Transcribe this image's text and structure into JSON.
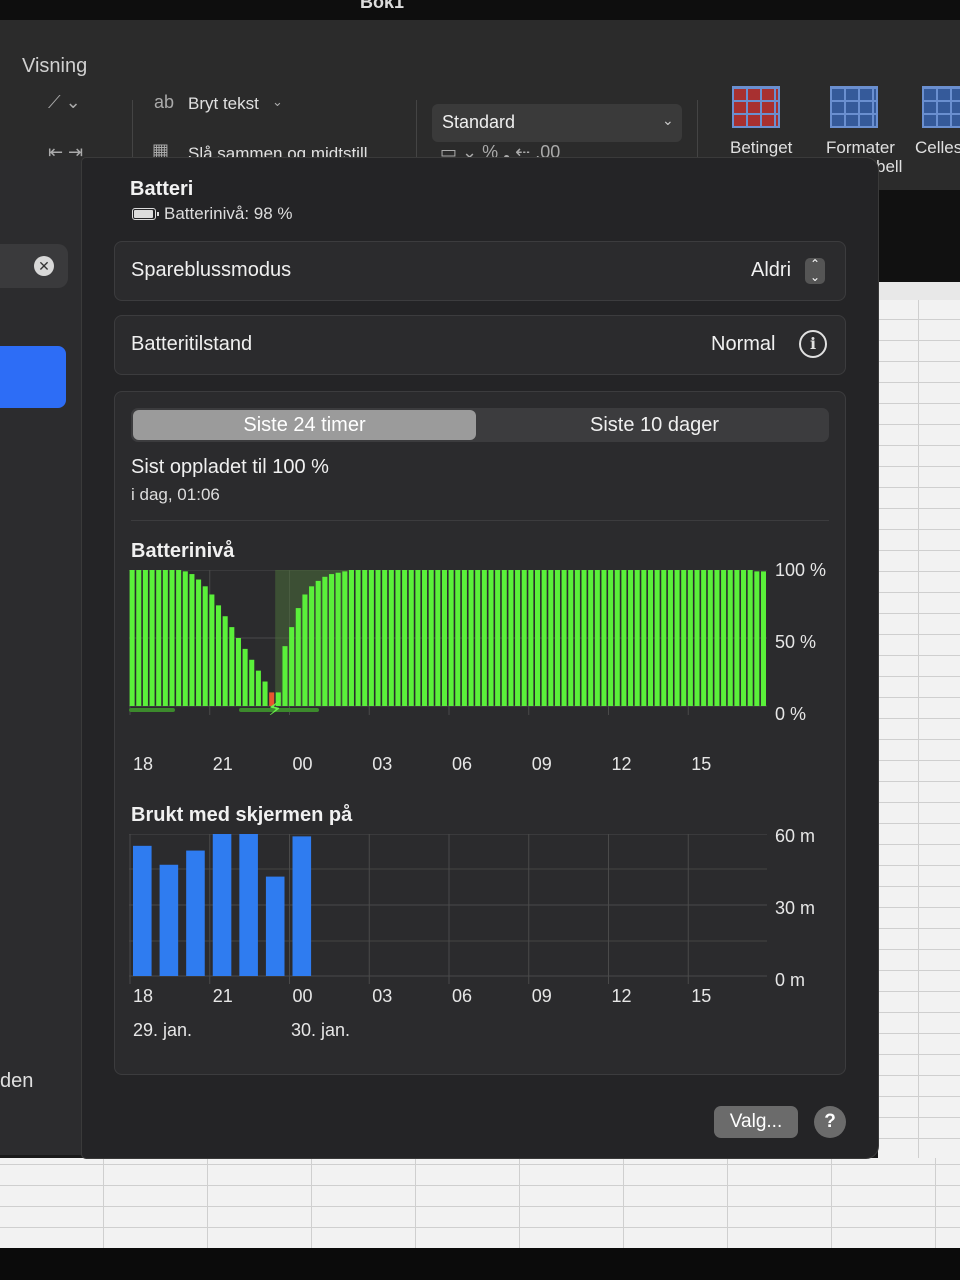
{
  "window": {
    "doc_title": "Bok1"
  },
  "ribbon": {
    "tab": "Visning",
    "wrap_text": "Bryt tekst",
    "merge_center": "Slå sammen og midtstill",
    "number_format": "Standard",
    "conditional": "Betinget",
    "format_table": "Formater",
    "format_table_2": "bell",
    "cell_styles": "Celles"
  },
  "settings": {
    "sidebar_partial_label": "den"
  },
  "battery_panel": {
    "title": "Batteri",
    "level_text": "Batterinivå: 98 %",
    "low_power_label": "Spareblussmodus",
    "low_power_value": "Aldri",
    "health_label": "Batteritilstand",
    "health_value": "Normal",
    "tabs": [
      "Siste 24 timer",
      "Siste 10 dager"
    ],
    "active_tab": "Siste 24 timer",
    "last_charged_title": "Sist oppladet til 100 %",
    "last_charged_time": "i dag, 01:06",
    "level_chart_title": "Batterinivå",
    "screen_chart_title": "Brukt med skjermen på",
    "options_button": "Valg...",
    "help_button": "?"
  },
  "chart_data": [
    {
      "type": "bar",
      "title": "Batterinivå",
      "x_tick_labels": [
        "18",
        "21",
        "00",
        "03",
        "06",
        "09",
        "12",
        "15"
      ],
      "y_tick_labels": [
        "100 %",
        "50 %",
        "0 %"
      ],
      "ylim": [
        0,
        100
      ],
      "grid": true,
      "bar_colors": {
        "normal": "#5af03a",
        "low": "#e8552e"
      },
      "charging_icon_near": "00",
      "levels_per_15min": [
        100,
        100,
        100,
        100,
        100,
        100,
        100,
        100,
        99,
        97,
        93,
        88,
        82,
        74,
        66,
        58,
        50,
        42,
        34,
        26,
        18,
        10,
        10,
        44,
        58,
        72,
        82,
        88,
        92,
        95,
        97,
        98,
        99,
        100,
        100,
        100,
        100,
        100,
        100,
        100,
        100,
        100,
        100,
        100,
        100,
        100,
        100,
        100,
        100,
        100,
        100,
        100,
        100,
        100,
        100,
        100,
        100,
        100,
        100,
        100,
        100,
        100,
        100,
        100,
        100,
        100,
        100,
        100,
        100,
        100,
        100,
        100,
        100,
        100,
        100,
        100,
        100,
        100,
        100,
        100,
        100,
        100,
        100,
        100,
        100,
        100,
        100,
        100,
        100,
        100,
        100,
        100,
        100,
        100,
        99,
        99
      ]
    },
    {
      "type": "bar",
      "title": "Brukt med skjermen på",
      "x_tick_labels": [
        "18",
        "21",
        "00",
        "03",
        "06",
        "09",
        "12",
        "15"
      ],
      "date_labels": [
        "29. jan.",
        "30. jan."
      ],
      "y_tick_labels": [
        "60 m",
        "30 m",
        "0 m"
      ],
      "ylim": [
        0,
        60
      ],
      "unit": "minutes",
      "grid": true,
      "bar_color": "#2f7cf0",
      "values_per_hour": [
        55,
        47,
        53,
        60,
        60,
        42,
        59,
        0,
        0,
        0,
        0,
        0,
        0,
        0,
        0,
        0,
        0,
        0,
        0,
        0,
        0,
        0,
        0,
        0
      ]
    }
  ]
}
